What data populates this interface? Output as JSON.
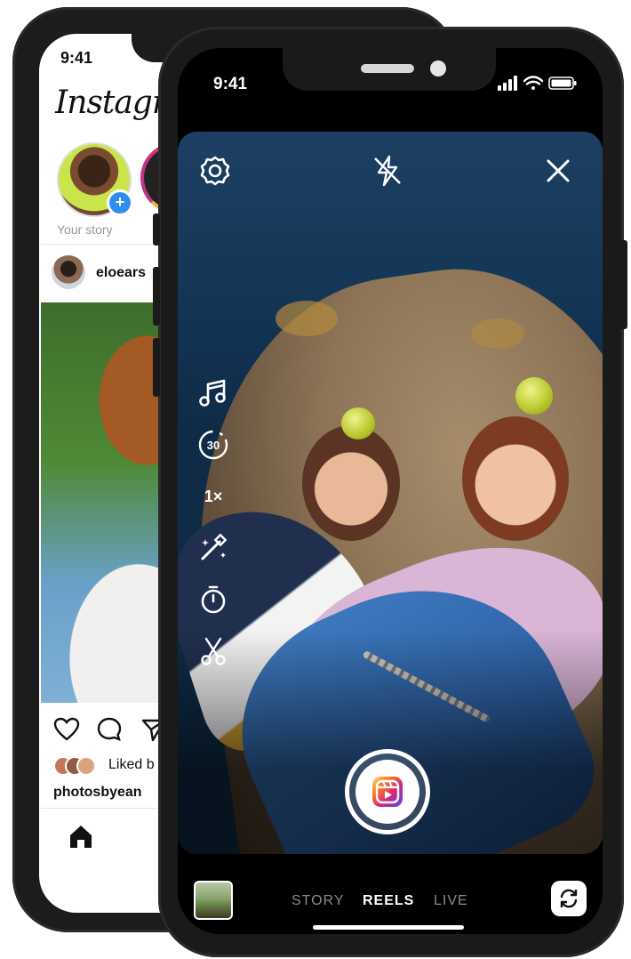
{
  "back_phone": {
    "status_time": "9:41",
    "app_logo": "Instagra",
    "story_label": "Your story",
    "post_username": "eloears",
    "liked_by": "Liked b",
    "caption_username": "photosbyean",
    "icons": [
      "heart-icon",
      "comment-icon",
      "share-icon",
      "home-icon"
    ]
  },
  "front_phone": {
    "status_time": "9:41",
    "top_icons": [
      "settings-icon",
      "flash-off-icon",
      "close-icon"
    ],
    "tools": {
      "audio_icon": "music-note-icon",
      "length_label": "30",
      "speed_label": "1×",
      "effects_icon": "magic-wand-icon",
      "timer_icon": "timer-icon",
      "align_icon": "scissors-icon"
    },
    "modes": [
      "STORY",
      "REELS",
      "LIVE"
    ],
    "active_mode": "REELS",
    "record_button_icon": "reels-icon",
    "flip_camera_icon": "flip-camera-icon"
  },
  "colors": {
    "reels_gradient": [
      "#feda75",
      "#fa7e1e",
      "#d62976",
      "#962fbf",
      "#4f5bd5"
    ],
    "story_plus": "#2e8ff0",
    "phone_frame": "#1a1a1a"
  }
}
